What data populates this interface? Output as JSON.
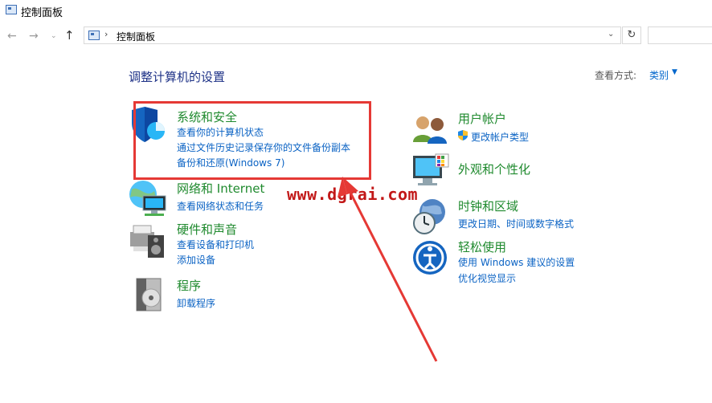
{
  "window": {
    "title": "控制面板"
  },
  "address": {
    "path": "控制面板",
    "separator": "›"
  },
  "nav": {
    "back": "←",
    "forward": "→",
    "dropdown": "⌄",
    "up": "↑",
    "refresh": "↻",
    "addr_dropdown": "⌄"
  },
  "header": {
    "title": "调整计算机的设置",
    "view_label": "查看方式:",
    "view_value": "类别",
    "view_caret": "▼"
  },
  "categories": {
    "security": {
      "title": "系统和安全",
      "links": [
        "查看你的计算机状态",
        "通过文件历史记录保存你的文件备份副本",
        "备份和还原(Windows 7)"
      ]
    },
    "network": {
      "title": "网络和 Internet",
      "links": [
        "查看网络状态和任务"
      ]
    },
    "hardware": {
      "title": "硬件和声音",
      "links": [
        "查看设备和打印机",
        "添加设备"
      ]
    },
    "programs": {
      "title": "程序",
      "links": [
        "卸载程序"
      ]
    },
    "accounts": {
      "title": "用户帐户",
      "links": [
        "更改帐户类型"
      ]
    },
    "appearance": {
      "title": "外观和个性化",
      "links": []
    },
    "clock": {
      "title": "时钟和区域",
      "links": [
        "更改日期、时间或数字格式"
      ]
    },
    "ease": {
      "title": "轻松使用",
      "links": [
        "使用 Windows 建议的设置",
        "优化视觉显示"
      ]
    }
  },
  "watermark": "www.dgrai.com",
  "colors": {
    "title_green": "#1f8a2e",
    "link_blue": "#0b63c4",
    "highlight_red": "#e53935",
    "heading_blue": "#1e3287"
  }
}
